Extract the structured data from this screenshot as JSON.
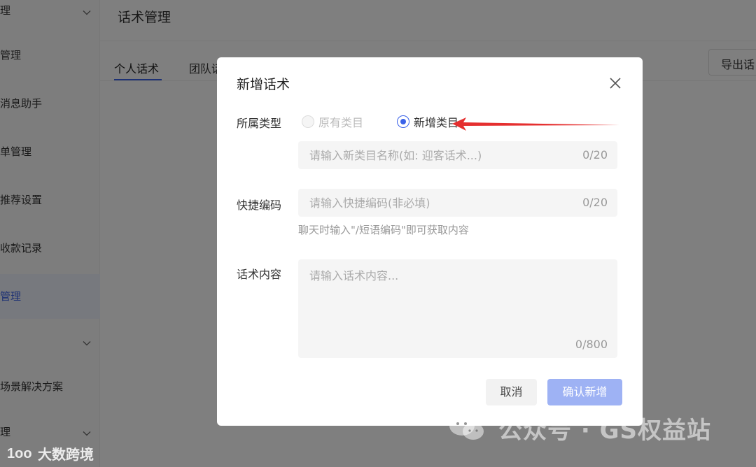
{
  "sidebar": {
    "items": [
      {
        "label": "理"
      },
      {
        "label": "管理"
      },
      {
        "label": "消息助手"
      },
      {
        "label": "单管理"
      },
      {
        "label": "推荐设置"
      },
      {
        "label": "收款记录"
      },
      {
        "label": "管理"
      },
      {
        "label": "场景解决方案"
      },
      {
        "label": "理"
      }
    ]
  },
  "page": {
    "title": "话术管理",
    "tabs": [
      "个人话术",
      "团队话"
    ],
    "export_label": "导出话"
  },
  "modal": {
    "title": "新增话术",
    "type_label": "所属类型",
    "radio_existing": "原有类目",
    "radio_new": "新增类目",
    "category_placeholder": "请输入新类目名称(如: 迎客话术...)",
    "category_counter": "0/20",
    "code_label": "快捷编码",
    "code_placeholder": "请输入快捷编码(非必填)",
    "code_counter": "0/20",
    "code_hint": "聊天时输入\"/短语编码\"即可获取内容",
    "content_label": "话术内容",
    "content_placeholder": "请输入话术内容...",
    "content_counter": "0/800",
    "cancel_label": "取消",
    "confirm_label": "确认新增"
  },
  "watermark": {
    "text": "公众号 · GS权益站",
    "brand": "大数跨境",
    "brand_logo": "1oo"
  },
  "colors": {
    "accent": "#3a62e8",
    "confirm_disabled": "#9eb2f4",
    "arrow": "#e52f2f"
  }
}
